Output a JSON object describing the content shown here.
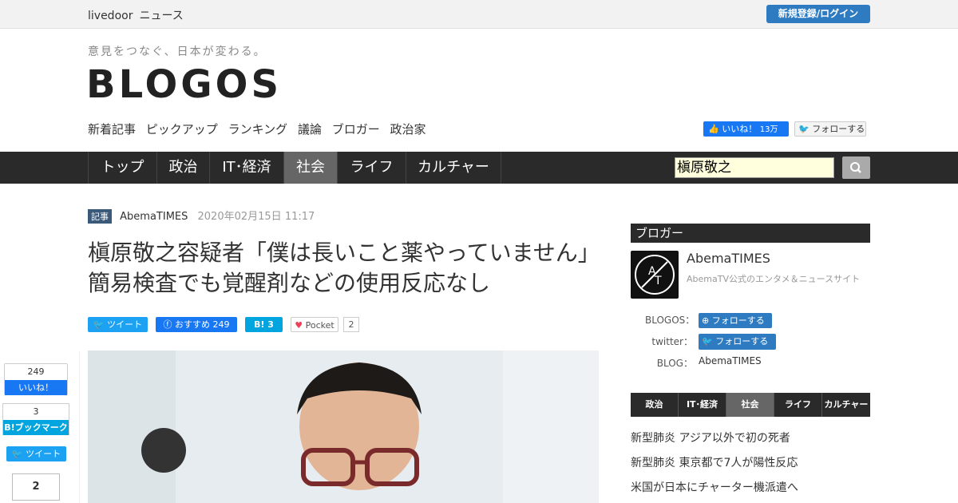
{
  "topbar": {
    "brand_a": "livedoor",
    "brand_b": "ニュース",
    "login": "新規登録/ログイン"
  },
  "header": {
    "tagline": "意見をつなぐ、日本が変わる。",
    "logo": "BLOGOS",
    "subnav": [
      "新着記事",
      "ピックアップ",
      "ランキング",
      "議論",
      "ブロガー",
      "政治家"
    ],
    "like_label": "いいね！",
    "like_count": "13万",
    "follow_label": "フォローする"
  },
  "mainnav": {
    "items": [
      "トップ",
      "政治",
      "IT･経済",
      "社会",
      "ライフ",
      "カルチャー"
    ],
    "active": "社会",
    "search_value": "槇原敬之"
  },
  "article": {
    "tag": "記事",
    "source": "AbemaTIMES",
    "date": "2020年02月15日 11:17",
    "title": "槇原敬之容疑者「僕は長いこと薬やっていません」 簡易検査でも覚醒剤などの使用反応なし",
    "share": {
      "tweet": "ツイート",
      "fb_label": "おすすめ",
      "fb_count": "249",
      "hb_label": "B!",
      "hb_count": "3",
      "pocket_label": "Pocket",
      "pocket_count": "2"
    }
  },
  "floating": {
    "like_count": "249",
    "like_label": "いいね！",
    "hb_count": "3",
    "hb_label": "B!ブックマーク",
    "tweet_label": "ツイート",
    "pocket_count": "2"
  },
  "sidebar": {
    "heading": "ブロガー",
    "name": "AbemaTIMES",
    "desc": "AbemaTV公式のエンタメ＆ニュースサイト",
    "blogos_label": "BLOGOS：",
    "twitter_label": "twitter：",
    "blog_label": "BLOG：",
    "follow_label": "フォローする",
    "blog_value": "AbemaTIMES",
    "tabs": [
      "政治",
      "IT･経済",
      "社会",
      "ライフ",
      "カルチャー"
    ],
    "active_tab": "社会",
    "news": [
      "新型肺炎 アジア以外で初の死者",
      "新型肺炎 東京都で7人が陽性反応",
      "米国が日本にチャーター機派遣へ"
    ]
  },
  "colors": {
    "nav_bg": "#2a2a2a",
    "accent_blue": "#2f7bc1",
    "facebook": "#1877f2",
    "twitter": "#1da1f2",
    "hatena": "#00a4de"
  }
}
